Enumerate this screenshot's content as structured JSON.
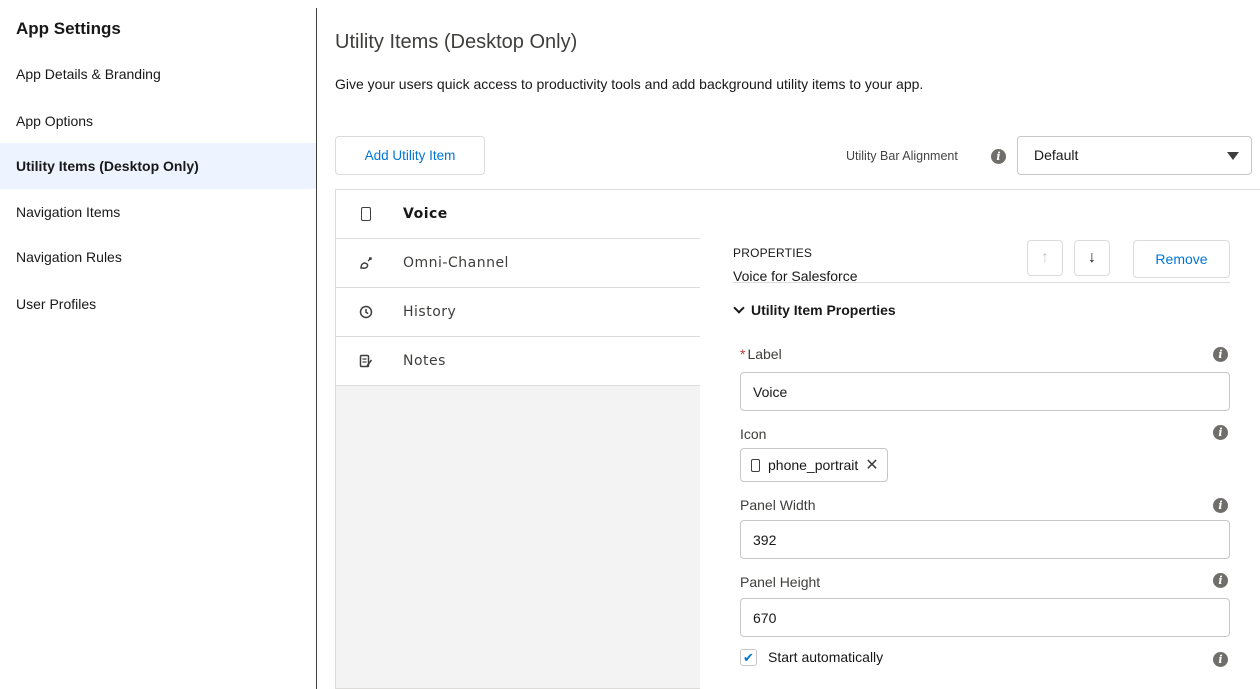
{
  "sidebar": {
    "title": "App Settings",
    "items": [
      {
        "label": "App Details & Branding"
      },
      {
        "label": "App Options"
      },
      {
        "label": "Utility Items (Desktop Only)",
        "active": true
      },
      {
        "label": "Navigation Items"
      },
      {
        "label": "Navigation Rules"
      },
      {
        "label": "User Profiles"
      }
    ]
  },
  "main": {
    "title": "Utility Items (Desktop Only)",
    "description": "Give your users quick access to productivity tools and add background utility items to your app.",
    "add_button_label": "Add Utility Item",
    "alignment": {
      "label": "Utility Bar Alignment",
      "value": "Default"
    }
  },
  "utility_items": [
    {
      "label": "Voice",
      "icon": "phone-portrait-icon",
      "selected": true
    },
    {
      "label": "Omni-Channel",
      "icon": "omni-channel-icon"
    },
    {
      "label": "History",
      "icon": "clock-icon"
    },
    {
      "label": "Notes",
      "icon": "notes-icon"
    }
  ],
  "properties": {
    "caption": "PROPERTIES",
    "subtitle": "Voice for Salesforce",
    "remove_label": "Remove",
    "section_title": "Utility Item Properties",
    "label_field": {
      "label": "Label",
      "value": "Voice"
    },
    "icon_field": {
      "label": "Icon",
      "value": "phone_portrait"
    },
    "panel_width": {
      "label": "Panel Width",
      "value": "392"
    },
    "panel_height": {
      "label": "Panel Height",
      "value": "670"
    },
    "start_auto": {
      "label": "Start automatically",
      "checked": true
    }
  },
  "colors": {
    "accent": "#0176d3",
    "active_nav_bg": "#eef4ff",
    "required": "#c23934"
  }
}
